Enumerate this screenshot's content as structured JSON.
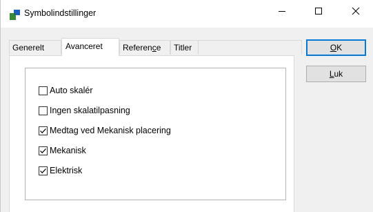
{
  "window": {
    "title": "Symbolindstillinger"
  },
  "tabs": [
    {
      "label": "Generelt",
      "active": false
    },
    {
      "label": "Avanceret",
      "active": true
    },
    {
      "label_before": "Referen",
      "label_mnemonic": "c",
      "label_after": "e",
      "active": false
    },
    {
      "label": "Titler",
      "active": false
    }
  ],
  "options": [
    {
      "label": "Auto skalér",
      "checked": false
    },
    {
      "label": "Ingen skalatilpasning",
      "checked": false
    },
    {
      "label": "Medtag ved Mekanisk placering",
      "checked": true
    },
    {
      "label": "Mekanisk",
      "checked": true
    },
    {
      "label": "Elektrisk",
      "checked": true
    }
  ],
  "buttons": {
    "ok_mnemonic": "O",
    "ok_rest": "K",
    "luk_mnemonic": "L",
    "luk_rest": "uk"
  },
  "colors": {
    "default_button_border": "#0078d7",
    "icon_green": "#3a8a3a",
    "icon_blue": "#1f5fbf"
  },
  "icons": {
    "app": "app-symbol-icon",
    "minimize": "minimize-icon",
    "maximize": "maximize-icon",
    "close": "close-icon",
    "check": "checkmark-icon"
  }
}
